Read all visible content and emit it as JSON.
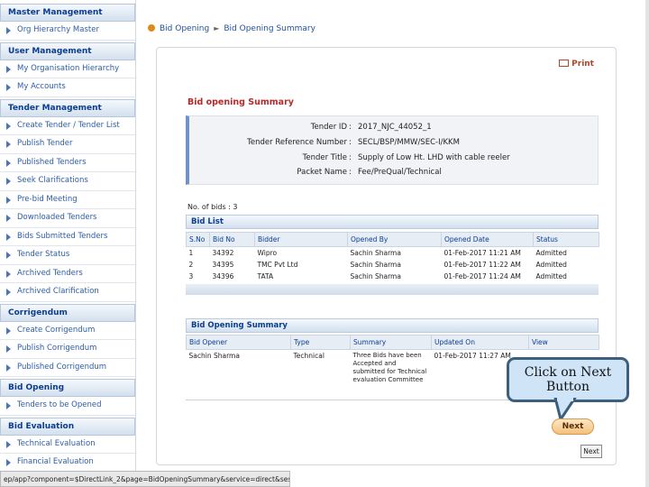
{
  "sidebar": {
    "sections": [
      {
        "title": "Master Management",
        "items": [
          "Org Hierarchy Master"
        ]
      },
      {
        "title": "User Management",
        "items": [
          "My Organisation Hierarchy",
          "My Accounts"
        ]
      },
      {
        "title": "Tender Management",
        "items": [
          "Create Tender / Tender List",
          "Publish Tender",
          "Published Tenders",
          "Seek Clarifications",
          "Pre-bid Meeting",
          "Downloaded Tenders",
          "Bids Submitted Tenders",
          "Tender Status",
          "Archived Tenders",
          "Archived Clarification"
        ]
      },
      {
        "title": "Corrigendum",
        "items": [
          "Create Corrigendum",
          "Publish Corrigendum",
          "Published Corrigendum"
        ]
      },
      {
        "title": "Bid Opening",
        "items": [
          "Tenders to be Opened"
        ]
      },
      {
        "title": "Bid Evaluation",
        "items": [
          "Technical Evaluation",
          "Financial Evaluation"
        ]
      }
    ]
  },
  "breadcrumb": {
    "first": "Bid Opening",
    "second": "Bid Opening Summary"
  },
  "print_label": "Print",
  "summary_title": "Bid opening Summary",
  "details": [
    {
      "label": "Tender ID",
      "value": "2017_NJC_44052_1"
    },
    {
      "label": "Tender Reference Number",
      "value": "SECL/BSP/MMW/SEC-I/KKM"
    },
    {
      "label": "Tender Title",
      "value": "Supply of Low Ht. LHD with cable reeler"
    },
    {
      "label": "Packet Name",
      "value": "Fee/PreQual/Technical"
    }
  ],
  "no_of_bids": "No. of bids : 3",
  "bid_list": {
    "title": "Bid List",
    "columns": [
      "S.No",
      "Bid No",
      "Bidder",
      "Opened By",
      "Opened Date",
      "Status"
    ],
    "rows": [
      [
        "1",
        "34392",
        "Wipro",
        "Sachin Sharma",
        "01-Feb-2017 11:21 AM",
        "Admitted"
      ],
      [
        "2",
        "34395",
        "TMC Pvt Ltd",
        "Sachin Sharma",
        "01-Feb-2017 11:22 AM",
        "Admitted"
      ],
      [
        "3",
        "34396",
        "TATA",
        "Sachin Sharma",
        "01-Feb-2017 11:24 AM",
        "Admitted"
      ]
    ]
  },
  "bid_opening_summary": {
    "title": "Bid Opening Summary",
    "columns": [
      "Bid Opener",
      "Type",
      "Summary",
      "Updated On",
      "View"
    ],
    "rows": [
      [
        "Sachin Sharma",
        "Technical",
        "Three Bids have been Accepted and submitted for Technical evaluation Committee",
        "01-Feb-2017 11:27 AM",
        ""
      ]
    ]
  },
  "callout": {
    "line1": "Click on Next",
    "line2": "Button"
  },
  "next_button": "Next",
  "next_button_small": "Next",
  "status_url": "ep/app?component=$DirectLink_2&page=BidOpeningSummary&service=direct&session=T",
  "colors": {
    "accent": "#0b3d91",
    "title_red": "#b52a2a",
    "callout_fill": "#cfe5f7",
    "next_orange": "#f3c07c"
  }
}
